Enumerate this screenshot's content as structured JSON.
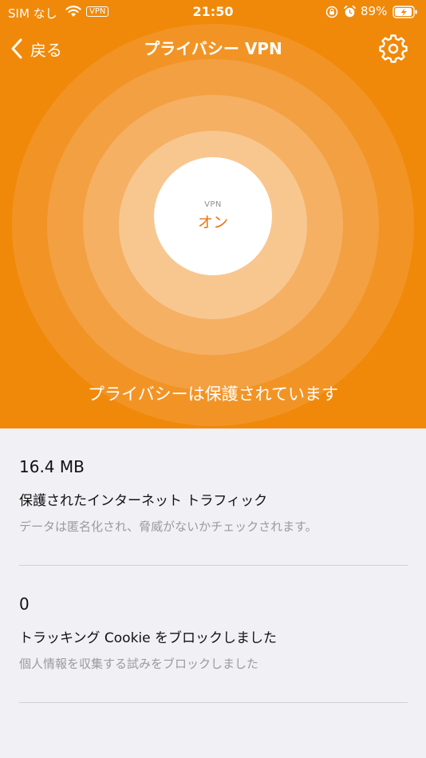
{
  "status_bar": {
    "carrier": "SIM なし",
    "vpn_badge": "VPN",
    "time": "21:50",
    "battery": "89%"
  },
  "nav": {
    "back_label": "戻る",
    "title": "プライバシー VPN",
    "settings_icon": "gear-icon"
  },
  "vpn_status": {
    "label": "VPN",
    "state": "オン"
  },
  "protection_message": "プライバシーは保護されています",
  "colors": {
    "brand_orange": "#f0890a",
    "state_text": "#e8740a"
  },
  "stats": [
    {
      "value": "16.4 MB",
      "label": "保護されたインターネット トラフィック",
      "description": "データは匿名化され、脅威がないかチェックされます。"
    },
    {
      "value": "0",
      "label": "トラッキング Cookie をブロックしました",
      "description": "個人情報を収集する試みをブロックしました"
    }
  ]
}
